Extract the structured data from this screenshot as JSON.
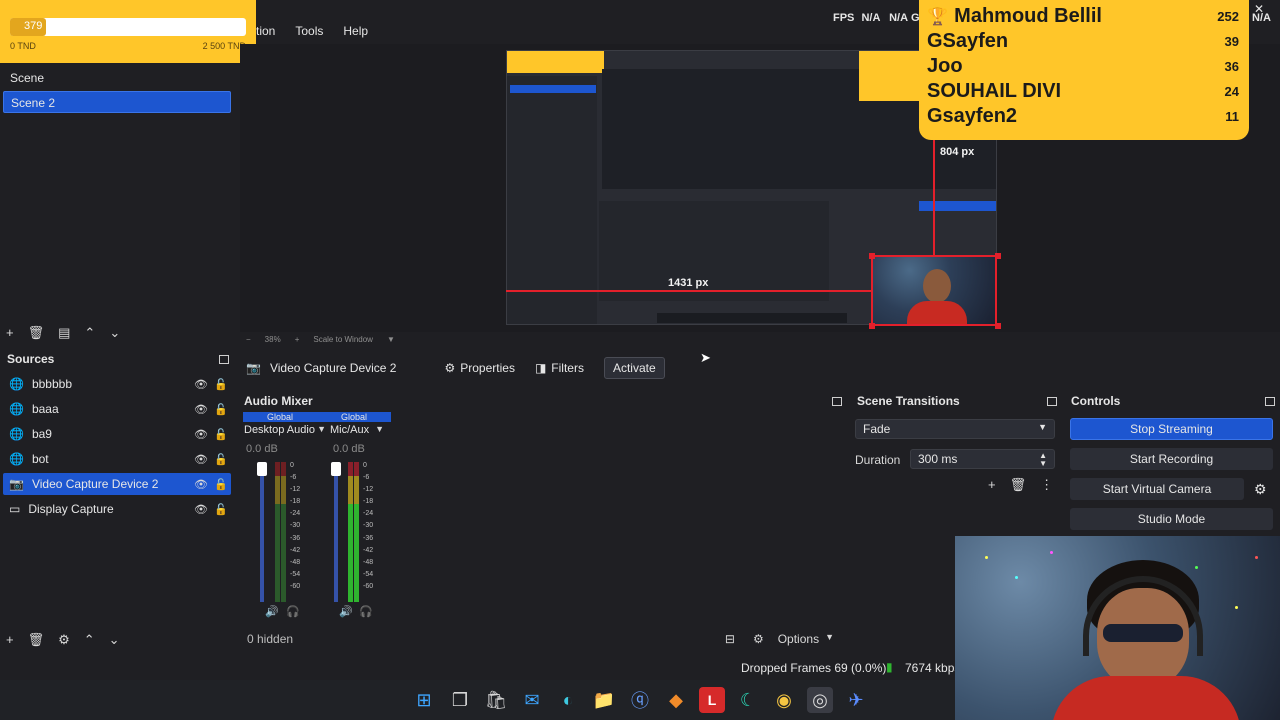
{
  "menu": {
    "items": [
      "tion",
      "Tools",
      "Help"
    ]
  },
  "stats": {
    "fps_label": "FPS",
    "fps_value": "N/A",
    "other_value": "N/A",
    "letter": "G",
    "right_value": "N/A"
  },
  "goal": {
    "current": "379",
    "min": "0 TND",
    "max": "2 500 TND",
    "progress_fraction": 0.1516
  },
  "leaderboard": [
    {
      "name": "Mahmoud Bellil",
      "score": "252"
    },
    {
      "name": "GSayfen",
      "score": "39"
    },
    {
      "name": "Joo",
      "score": "36"
    },
    {
      "name": "SOUHAIL DIVI",
      "score": "24"
    },
    {
      "name": "Gsayfen2",
      "score": "11"
    }
  ],
  "scenes": {
    "items": [
      "Scene",
      "Scene 2"
    ],
    "selected": 1
  },
  "preview": {
    "height_label": "804 px",
    "width_label": "1431 px",
    "zoom": "38%",
    "scale_mode": "Scale to Window"
  },
  "source_toolbar": {
    "name": "Video Capture Device 2",
    "properties": "Properties",
    "filters": "Filters",
    "activate": "Activate"
  },
  "sources": {
    "title": "Sources",
    "items": [
      "bbbbbb",
      "baaa",
      "ba9",
      "bot",
      "Video Capture Device 2",
      "Display Capture"
    ],
    "selected": 4
  },
  "mixer": {
    "title": "Audio Mixer",
    "channels": [
      {
        "tag": "Global",
        "name": "Desktop Audio",
        "db": "0.0 dB"
      },
      {
        "tag": "Global",
        "name": "Mic/Aux",
        "db": "0.0 dB"
      }
    ],
    "scale": [
      "0",
      "-6",
      "-12",
      "-18",
      "-24",
      "-30",
      "-36",
      "-42",
      "-48",
      "-54",
      "-60"
    ],
    "hidden": "0 hidden",
    "options": "Options"
  },
  "transitions": {
    "title": "Scene Transitions",
    "type": "Fade",
    "duration_label": "Duration",
    "duration_value": "300 ms"
  },
  "controls": {
    "title": "Controls",
    "stop_streaming": "Stop Streaming",
    "start_recording": "Start Recording",
    "start_virtual_camera": "Start Virtual Camera",
    "studio_mode": "Studio Mode"
  },
  "status": {
    "dropped_frames": "Dropped Frames 69 (0.0%)",
    "bitrate": "7674 kbps"
  },
  "colors": {
    "accent": "#1d56d0",
    "overlay_yellow": "#ffc629",
    "guide_red": "#e3202b",
    "background": "#1f1f23"
  }
}
